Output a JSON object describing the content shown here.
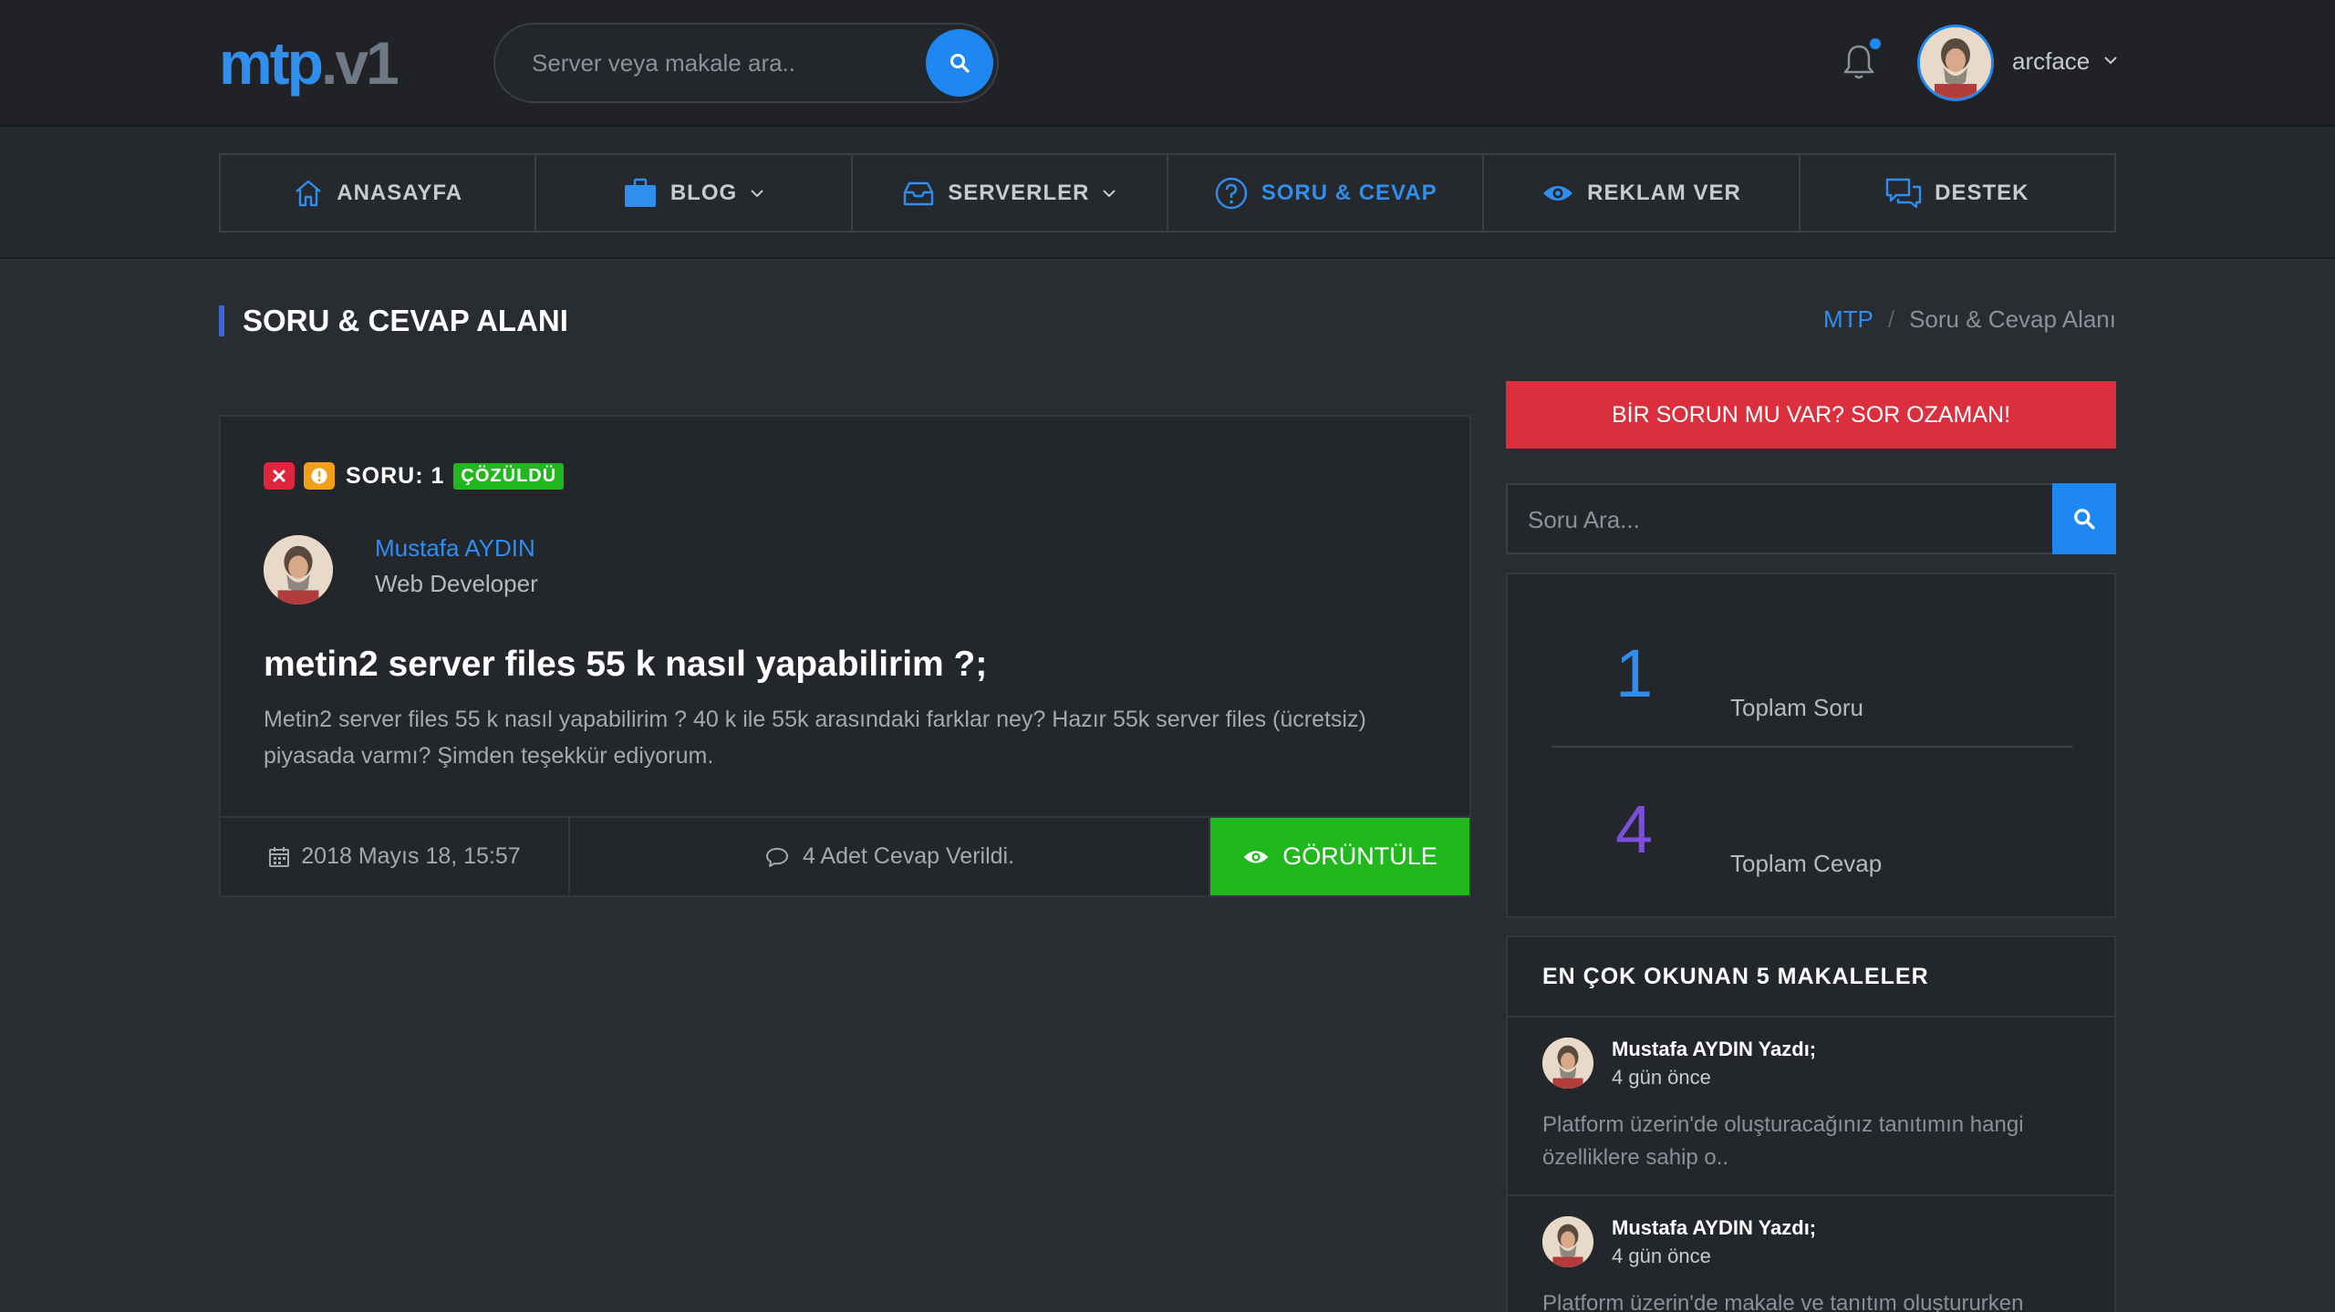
{
  "header": {
    "logo_part1": "mtp",
    "logo_part2": ".v1",
    "search_placeholder": "Server veya makale ara..",
    "username": "arcface"
  },
  "nav": {
    "items": [
      {
        "label": "ANASAYFA",
        "icon": "home-icon",
        "has_dropdown": false
      },
      {
        "label": "BLOG",
        "icon": "briefcase-icon",
        "has_dropdown": true
      },
      {
        "label": "SERVERLER",
        "icon": "inbox-icon",
        "has_dropdown": true
      },
      {
        "label": "SORU & CEVAP",
        "icon": "question-circle-icon",
        "has_dropdown": false,
        "active": true
      },
      {
        "label": "REKLAM VER",
        "icon": "eye-icon",
        "has_dropdown": false
      },
      {
        "label": "DESTEK",
        "icon": "chat-icon",
        "has_dropdown": false
      }
    ]
  },
  "page": {
    "title": "SORU & CEVAP ALANI",
    "breadcrumb_home": "MTP",
    "breadcrumb_sep": "/",
    "breadcrumb_current": "Soru & Cevap Alanı"
  },
  "question": {
    "number_label": "SORU: 1",
    "status": "ÇÖZÜLDÜ",
    "author": "Mustafa AYDIN",
    "role": "Web Developer",
    "title": "metin2 server files 55 k nasıl yapabilirim ?;",
    "body": "Metin2 server files 55 k nasıl yapabilirim ? 40 k ile 55k arasındaki farklar ney? Hazır 55k server files (ücretsiz) piyasada varmı? Şimden teşekkür ediyorum.",
    "date": "2018 Mayıs 18, 15:57",
    "answers": "4 Adet Cevap Verildi.",
    "view_label": "GÖRÜNTÜLE"
  },
  "sidebar": {
    "ask_button": "BİR SORUN MU VAR? SOR OZAMAN!",
    "search_placeholder": "Soru Ara...",
    "stats": [
      {
        "value": "1",
        "label": "Toplam Soru",
        "color": "#2f8eee"
      },
      {
        "value": "4",
        "label": "Toplam Cevap",
        "color": "#7b4fd8"
      }
    ],
    "popular_title": "EN ÇOK OKUNAN 5 MAKALELER",
    "popular_items": [
      {
        "author": "Mustafa AYDIN Yazdı;",
        "time": "4 gün önce",
        "excerpt": "Platform üzerin'de oluşturacağınız tanıtımın hangi özelliklere sahip o.."
      },
      {
        "author": "Mustafa AYDIN Yazdı;",
        "time": "4 gün önce",
        "excerpt": "Platform üzerin'de makale ve tanıtım oluştururken"
      }
    ]
  },
  "colors": {
    "accent": "#1e88f0",
    "success": "#20b81c",
    "danger": "#dc2f3e",
    "warning": "#f0a01a"
  }
}
